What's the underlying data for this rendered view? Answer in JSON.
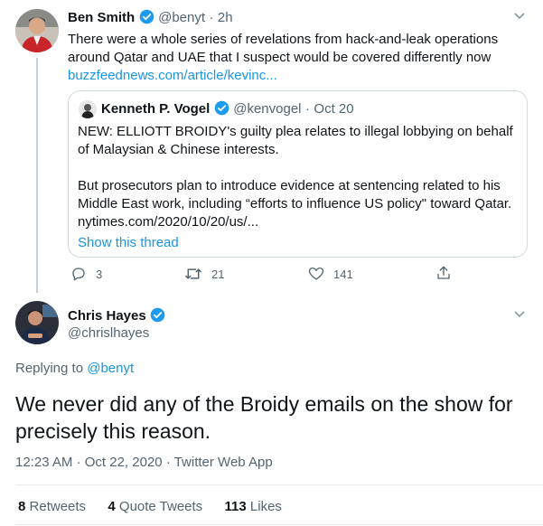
{
  "colors": {
    "accent": "#1b95e0",
    "text": "#0f1419",
    "muted": "#536471",
    "border": "#cfd9de"
  },
  "tweet1": {
    "name": "Ben Smith",
    "handle": "@benyt",
    "time": "2h",
    "line1": "There were a whole series of revelations from hack-and-leak operations",
    "line2": "around Qatar and UAE that I suspect would be covered differently now",
    "link": "buzzfeednews.com/article/kevinc...",
    "quote": {
      "name": "Kenneth P. Vogel",
      "handle": "@kenvogel",
      "date": "Oct 20",
      "p1_line1": "NEW: ELLIOTT BROIDY's guilty plea relates to illegal lobbying on behalf",
      "p1_line2": "of Malaysian & Chinese interests.",
      "p2_line1": "But prosecutors plan to introduce evidence at sentencing related to his",
      "p2_line2": "Middle East work, including “efforts to influence US policy\" toward Qatar.",
      "p2_line3": "nytimes.com/2020/10/20/us/...",
      "show_thread": "Show this thread"
    },
    "actions": {
      "replies": "3",
      "retweets": "21",
      "likes": "141"
    }
  },
  "tweet2": {
    "name": "Chris Hayes",
    "handle": "@chrislhayes",
    "replying_prefix": "Replying to",
    "replying_to": "@benyt",
    "line1": "We never did any of the Broidy emails on the show for",
    "line2": "precisely this reason.",
    "time": "12:23 AM",
    "date": "Oct 22, 2020",
    "source": "Twitter Web App",
    "stats": {
      "retweets_count": "8",
      "retweets_label": "Retweets",
      "quotes_count": "4",
      "quotes_label": "Quote Tweets",
      "likes_count": "113",
      "likes_label": "Likes"
    }
  }
}
